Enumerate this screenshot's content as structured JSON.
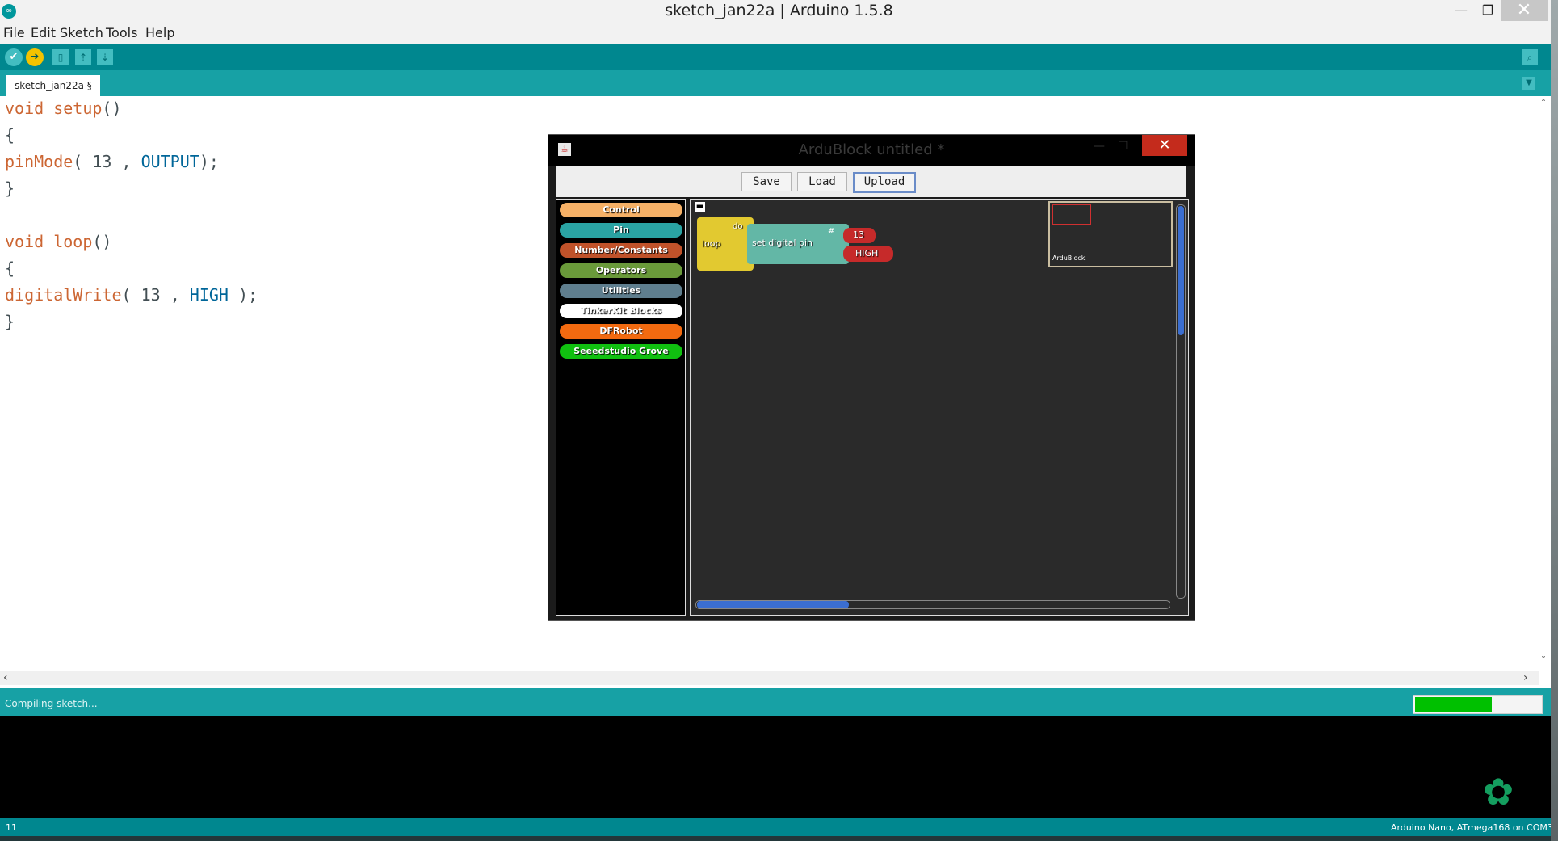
{
  "window": {
    "title": "sketch_jan22a | Arduino 1.5.8",
    "icon": "arduino-icon"
  },
  "menu": {
    "items": [
      "File",
      "Edit",
      "Sketch",
      "Tools",
      "Help"
    ]
  },
  "toolbar": {
    "icons": [
      "verify-icon",
      "upload-icon",
      "new-icon",
      "open-icon",
      "save-icon",
      "serial-monitor-icon"
    ]
  },
  "tabs": {
    "active": "sketch_jan22a §"
  },
  "code": {
    "lines": [
      {
        "a": "void",
        "b": " setup",
        "c": "()"
      },
      {
        "a": "{"
      },
      {
        "a": "pinMode",
        "b": "( 13 , ",
        "c": "OUTPUT",
        "d": ");"
      },
      {
        "a": "}"
      },
      {
        "a": ""
      },
      {
        "a": "void",
        "b": " loop",
        "c": "()"
      },
      {
        "a": "{"
      },
      {
        "a": "digitalWrite",
        "b": "( 13 , ",
        "c": "HIGH",
        "d": " );"
      },
      {
        "a": "}"
      }
    ]
  },
  "status": {
    "text": "Compiling sketch...",
    "progress": 0.61
  },
  "footer": {
    "line": "11",
    "board": "Arduino Nano, ATmega168 on COM3"
  },
  "ardublock": {
    "title": "ArduBlock untitled *",
    "buttons": {
      "save": "Save",
      "load": "Load",
      "upload": "Upload"
    },
    "palette": [
      {
        "label": "Control",
        "color": "#f5b066"
      },
      {
        "label": "Pin",
        "color": "#2aa3a3"
      },
      {
        "label": "Number/Constants",
        "color": "#c0522a"
      },
      {
        "label": "Operators",
        "color": "#6a9a3a"
      },
      {
        "label": "Utilities",
        "color": "#5f7e8e"
      },
      {
        "label": "TinkerKit Blocks",
        "color": "#ffffff"
      },
      {
        "label": "DFRobot",
        "color": "#f26a10"
      },
      {
        "label": "Seeedstudio Grove",
        "color": "#10c010"
      }
    ],
    "blocks": {
      "loop": "loop",
      "do": "do",
      "set_pin": "set digital pin",
      "hash": "#",
      "pin": "13",
      "value": "HIGH"
    },
    "minimap_label": "ArduBlock"
  }
}
